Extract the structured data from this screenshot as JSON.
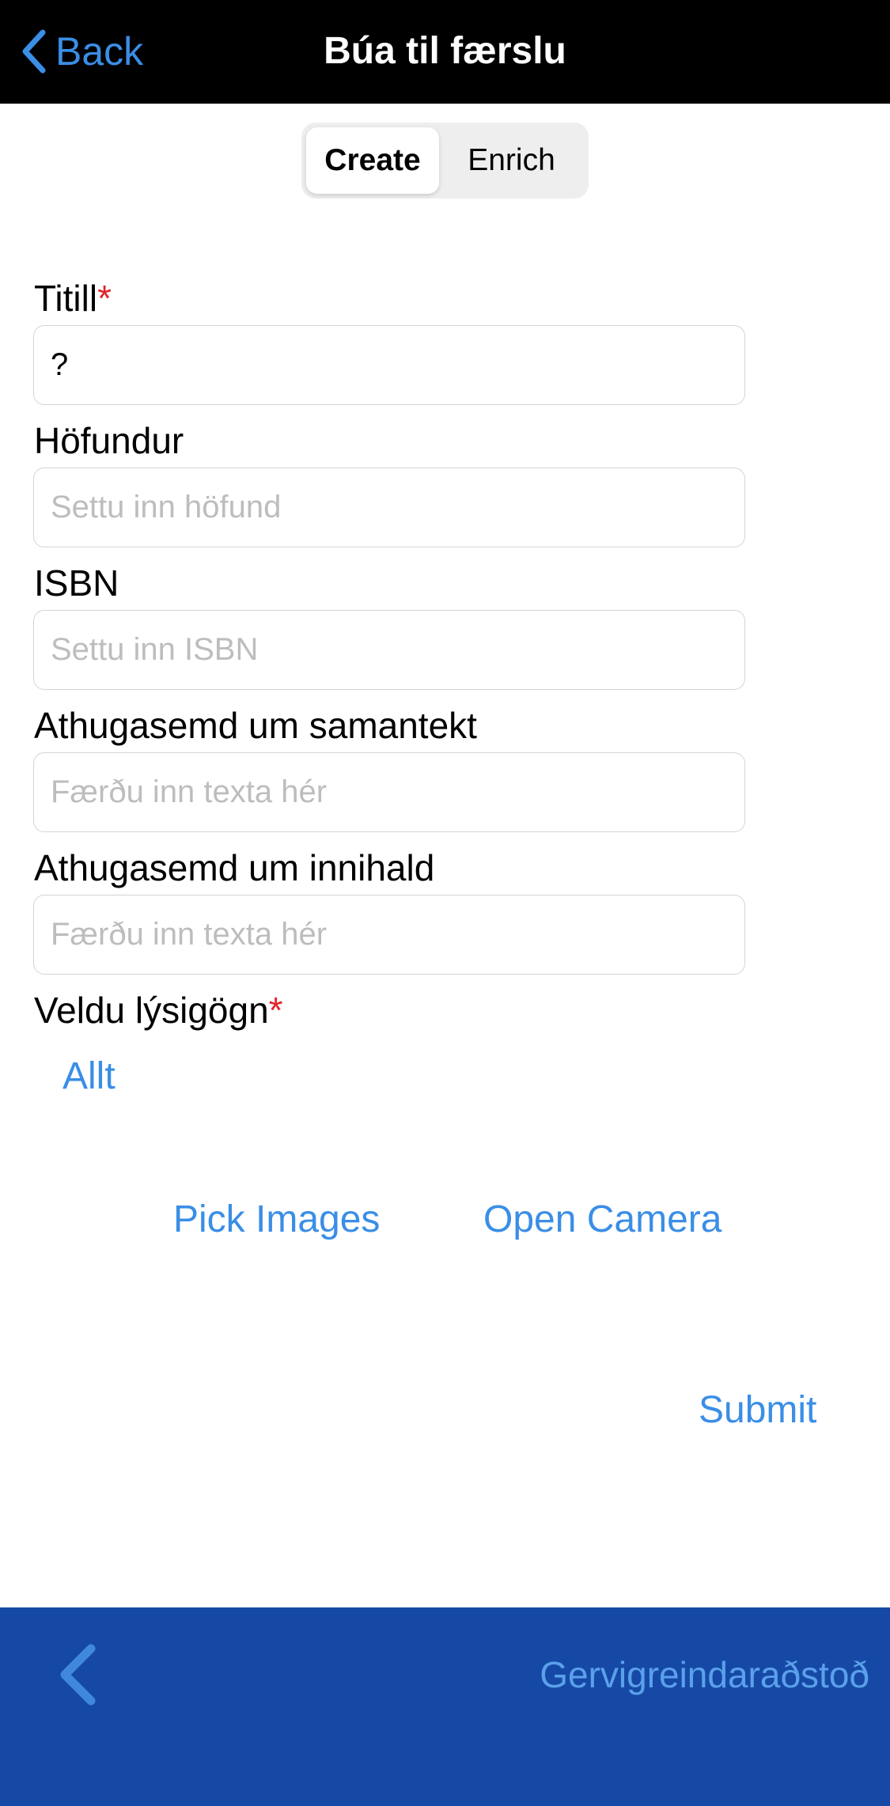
{
  "navbar": {
    "back_label": "Back",
    "title": "Búa til færslu"
  },
  "segmented": {
    "options": [
      "Create",
      "Enrich"
    ],
    "selected": "Create"
  },
  "form": {
    "title": {
      "label": "Titill",
      "required_mark": "*",
      "value": "?"
    },
    "author": {
      "label": "Höfundur",
      "placeholder": "Settu inn höfund"
    },
    "isbn": {
      "label": "ISBN",
      "placeholder": "Settu inn ISBN"
    },
    "summary_note": {
      "label": "Athugasemd um samantekt",
      "placeholder": "Færðu inn texta hér"
    },
    "content_note": {
      "label": "Athugasemd um innihald",
      "placeholder": "Færðu inn texta hér"
    },
    "metadata": {
      "label": "Veldu lýsigögn",
      "required_mark": "*",
      "selected": "Allt"
    }
  },
  "actions": {
    "pick_images": "Pick Images",
    "open_camera": "Open Camera",
    "submit": "Submit"
  },
  "bottombar": {
    "assistant_label": "Gervigreindaraðstoð"
  },
  "colors": {
    "accent": "#3a8ee6",
    "bottombar": "#1649a6",
    "required": "#e0242b"
  }
}
